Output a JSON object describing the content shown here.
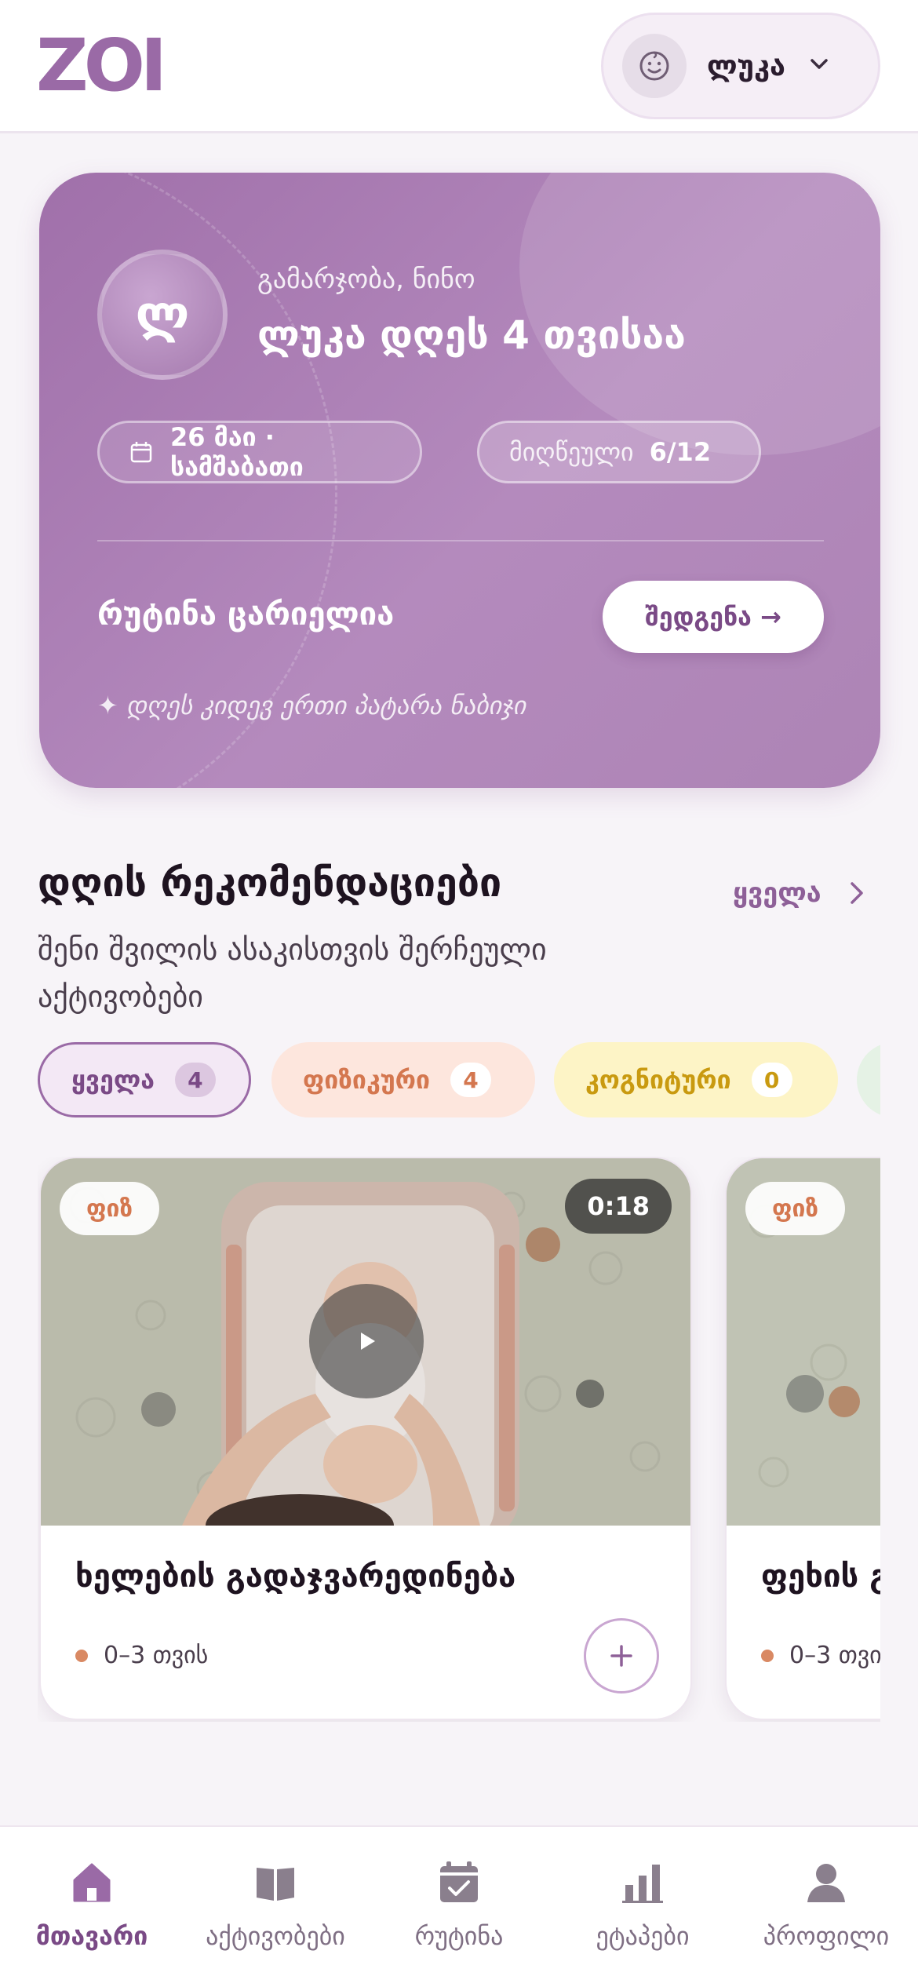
{
  "header": {
    "logo": "ZOI",
    "child_selector": {
      "name": "ლუკა",
      "avatar_icon": "baby-face-icon"
    }
  },
  "hero": {
    "avatar_initial": "ლ",
    "greeting": "გამარჯობა, ნინო",
    "title": "ლუკა დღეს 4 თვისაა",
    "date_chip": "26 მაი · სამშაბათი",
    "progress_label": "მიღწეული",
    "progress_value": "6/12",
    "routine_status": "რუტინა ცარიელია",
    "create_button": "შედგენა →",
    "tip": "✦ დღეს კიდევ ერთი პატარა ნაბიჯი"
  },
  "recommendations": {
    "title": "დღის რეკომენდაციები",
    "subtitle": "შენი შვილის ასაკისთვის შერჩეული აქტივობები",
    "see_all": "ყველა",
    "filters": [
      {
        "label": "ყველა",
        "count": "4",
        "active": true
      },
      {
        "label": "ფიზიკური",
        "count": "4",
        "color": "#d4774f"
      },
      {
        "label": "კოგნიტური",
        "count": "0",
        "color": "#c99a10"
      }
    ],
    "cards": [
      {
        "tag": "ფიზ",
        "duration": "0:18",
        "title": "ხელების გადაჯვარედინება",
        "age": "0–3 თვის"
      },
      {
        "tag": "ფიზ",
        "title": "ფეხის გ",
        "age": "0–3 თვი"
      }
    ]
  },
  "bottom_nav": [
    {
      "label": "მთავარი",
      "icon": "home-icon",
      "active": true
    },
    {
      "label": "აქტივობები",
      "icon": "book-icon",
      "active": false
    },
    {
      "label": "რუტინა",
      "icon": "calendar-check-icon",
      "active": false
    },
    {
      "label": "ეტაპები",
      "icon": "bar-chart-icon",
      "active": false
    },
    {
      "label": "პროფილი",
      "icon": "user-icon",
      "active": false
    }
  ],
  "colors": {
    "accent": "#9a6aa6",
    "physical": "#d4774f",
    "cognitive": "#c99a10"
  }
}
